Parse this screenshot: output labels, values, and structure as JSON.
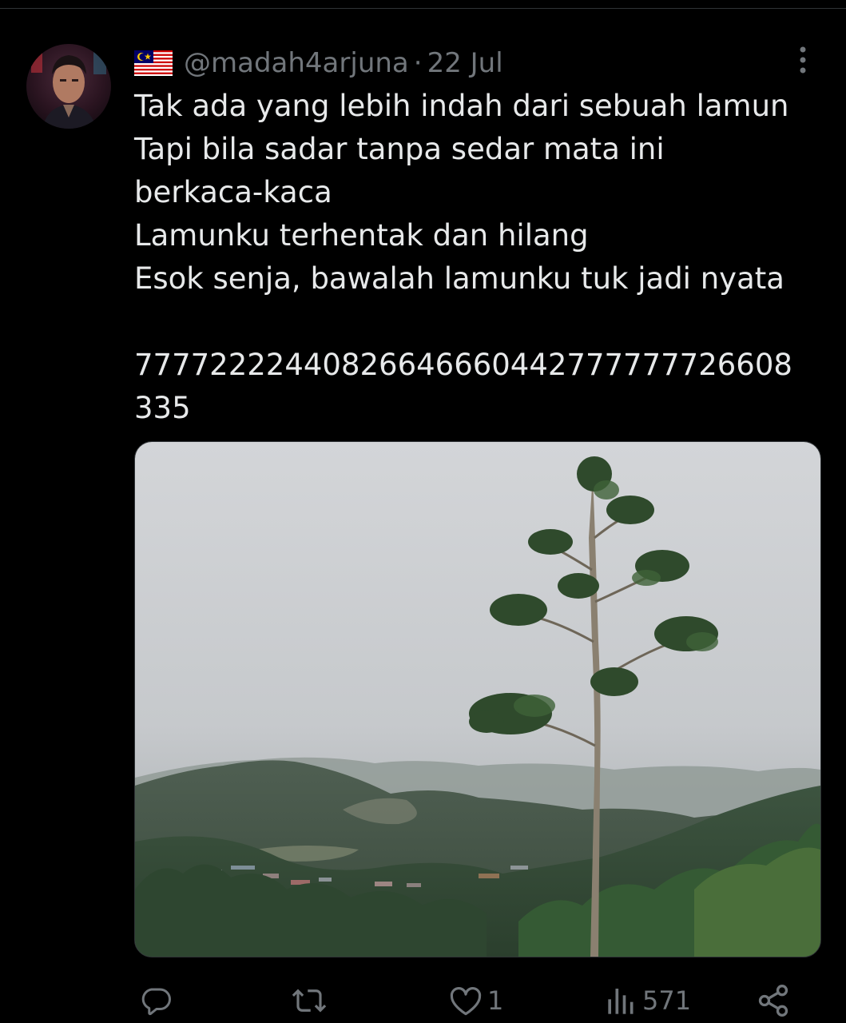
{
  "tweet": {
    "handle": "@madah4arjuna",
    "separator": "·",
    "date": "22 Jul",
    "lines": [
      "Tak ada yang lebih indah dari sebuah lamun",
      "Tapi bila sadar tanpa sedar mata ini",
      "berkaca-kaca",
      "Lamunku terhentak dan hilang",
      "Esok senja, bawalah lamunku tuk jadi nyata"
    ],
    "number_text": "7777222244082664666044277777772660833 5",
    "number_line_1": "7777222244082664666044277777772 6608",
    "number_line_2": "335"
  },
  "actions": {
    "reply_icon": "reply-icon",
    "retweet_icon": "retweet-icon",
    "like_icon": "heart-icon",
    "like_count": "1",
    "views_icon": "views-bar-chart-icon",
    "views_count": "571",
    "share_icon": "share-icon"
  },
  "colors": {
    "background": "#000000",
    "text_primary": "#e7e9ea",
    "text_secondary": "#71767b"
  }
}
